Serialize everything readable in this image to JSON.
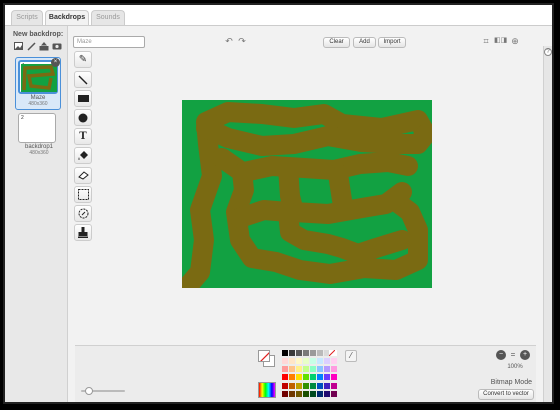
{
  "tabs": [
    {
      "label": "Scripts"
    },
    {
      "label": "Backdrops"
    },
    {
      "label": "Sounds"
    }
  ],
  "sidebar": {
    "title": "New backdrop:",
    "icons": [
      "paint-icon",
      "brush-icon",
      "upload-icon",
      "camera-icon"
    ],
    "backdrops": [
      {
        "number": "1",
        "name": "Maze",
        "size": "480x360"
      },
      {
        "number": "2",
        "name": "backdrop1",
        "size": "480x360"
      }
    ]
  },
  "editor": {
    "name_placeholder": "Maze",
    "clear_label": "Clear",
    "add_label": "Add",
    "import_label": "Import",
    "zoom_label": "100%",
    "mode_label": "Bitmap Mode",
    "convert_label": "Convert to vector"
  },
  "colors": {
    "background": "#12a142",
    "maze_path": "#7a6a12",
    "selection": "#4a90d9"
  },
  "palette": [
    "#000000",
    "#3a3a3a",
    "#5a5a5a",
    "#7a7a7a",
    "#9a9a9a",
    "#bababa",
    "#dadada",
    "#ffffff",
    "#ffd8d8",
    "#ffe6c8",
    "#fff8c8",
    "#e8ffc8",
    "#c8ffe6",
    "#c8e8ff",
    "#dcd0ff",
    "#ffd0f0",
    "#ff9a9a",
    "#ffc48a",
    "#fff08a",
    "#c4ff8a",
    "#8affc4",
    "#8ac4ff",
    "#b49aff",
    "#ff9ae0",
    "#ff0000",
    "#ff8000",
    "#ffe000",
    "#60e000",
    "#00d070",
    "#0080ff",
    "#6a3aff",
    "#ff00c0",
    "#c00000",
    "#c06000",
    "#c0a000",
    "#309000",
    "#008a40",
    "#0050c0",
    "#4020c0",
    "#c00090",
    "#700000",
    "#703800",
    "#705800",
    "#1a5000",
    "#004a20",
    "#002a70",
    "#200a70",
    "#700050"
  ]
}
